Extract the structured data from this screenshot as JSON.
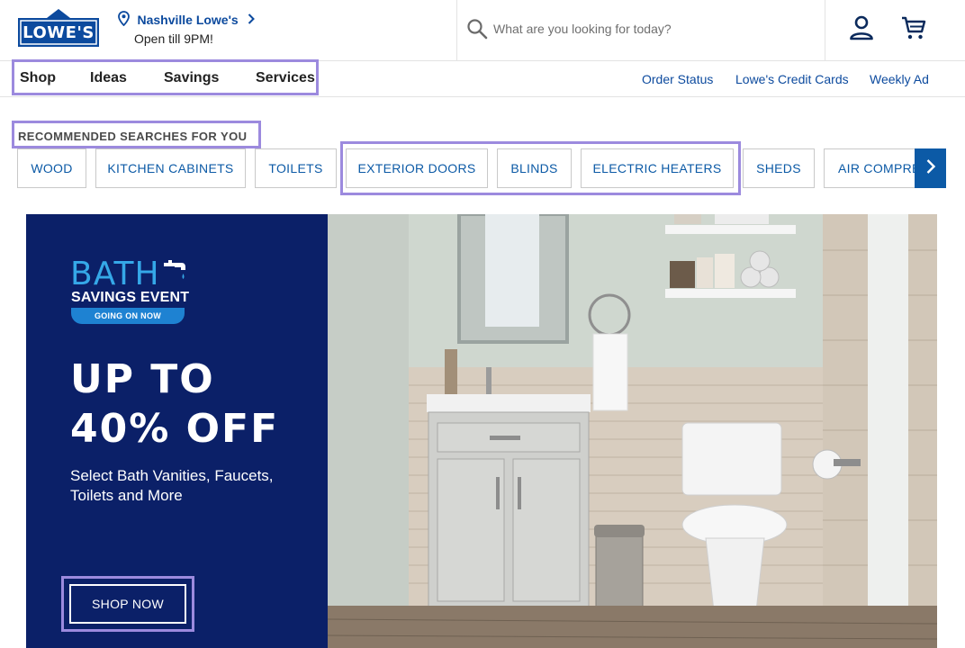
{
  "header": {
    "logo_text": "LOWE'S",
    "store_name": "Nashville Lowe's",
    "store_hours": "Open till 9PM!",
    "search_placeholder": "What are you looking for today?",
    "icons": [
      "location-pin-icon",
      "chevron-right-icon",
      "search-icon",
      "account-icon",
      "cart-icon"
    ]
  },
  "nav": {
    "main": [
      "Shop",
      "Ideas",
      "Savings",
      "Services"
    ],
    "utility": [
      "Order Status",
      "Lowe's Credit Cards",
      "Weekly Ad"
    ]
  },
  "recommended": {
    "title": "RECOMMENDED SEARCHES FOR YOU",
    "pills": [
      "WOOD",
      "KITCHEN CABINETS",
      "TOILETS",
      "EXTERIOR DOORS",
      "BLINDS",
      "ELECTRIC HEATERS",
      "SHEDS",
      "AIR COMPRE"
    ]
  },
  "hero": {
    "event_title": "BATH",
    "event_subtitle": "SAVINGS EVENT",
    "badge": "GOING ON NOW",
    "headline_1": "UP TO",
    "headline_2": "40% OFF",
    "subtext": "Select Bath Vanities, Faucets, Toilets and More",
    "cta": "SHOP NOW"
  },
  "colors": {
    "brand_blue": "#0c4a9e",
    "hero_navy": "#0b2068",
    "accent_light_blue": "#35a8e8",
    "highlight_purple": "#9c8ade"
  }
}
